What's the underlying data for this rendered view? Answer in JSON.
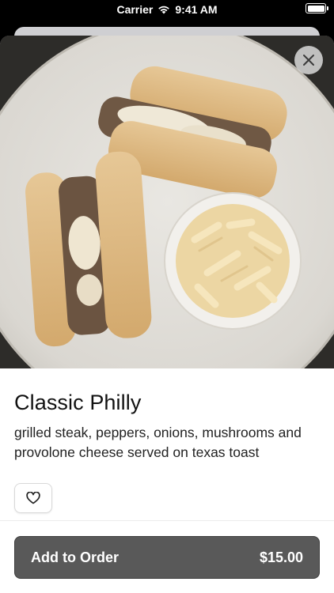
{
  "status_bar": {
    "carrier": "Carrier",
    "time": "9:41 AM"
  },
  "item": {
    "name": "Classic Philly",
    "description": "grilled steak, peppers, onions, mushrooms and provolone cheese served on texas toast"
  },
  "actions": {
    "add_to_order_label": "Add to Order",
    "price": "$15.00"
  },
  "icons": {
    "close": "close-icon",
    "favorite": "heart-icon",
    "wifi": "wifi-icon",
    "battery": "battery-icon"
  },
  "colors": {
    "primary_button": "#595959",
    "background": "#ffffff"
  }
}
